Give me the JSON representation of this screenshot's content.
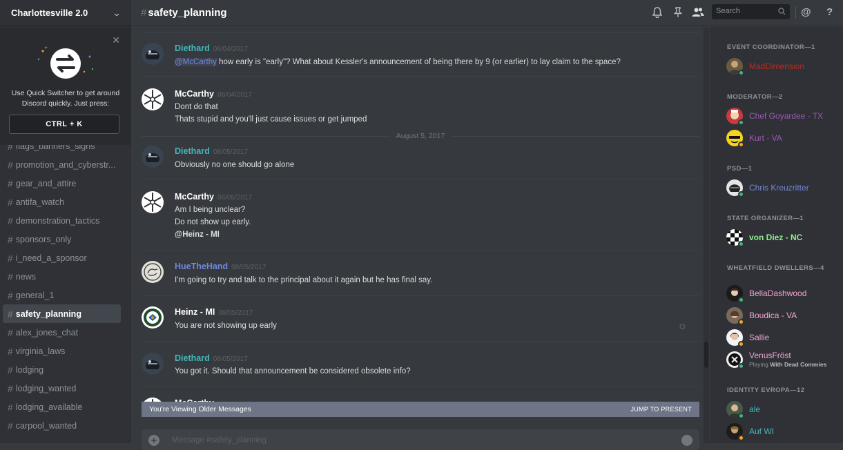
{
  "server": {
    "name": "Charlottesville 2.0"
  },
  "quick_switcher": {
    "text": "Use Quick Switcher to get around Discord quickly. Just press:",
    "shortcut": "CTRL + K"
  },
  "channels": [
    {
      "name": "flags_banners_signs",
      "active": false
    },
    {
      "name": "promotion_and_cyberstr...",
      "active": false
    },
    {
      "name": "gear_and_attire",
      "active": false
    },
    {
      "name": "antifa_watch",
      "active": false
    },
    {
      "name": "demonstration_tactics",
      "active": false
    },
    {
      "name": "sponsors_only",
      "active": false
    },
    {
      "name": "i_need_a_sponsor",
      "active": false
    },
    {
      "name": "news",
      "active": false
    },
    {
      "name": "general_1",
      "active": false
    },
    {
      "name": "safety_planning",
      "active": true
    },
    {
      "name": "alex_jones_chat",
      "active": false
    },
    {
      "name": "virginia_laws",
      "active": false
    },
    {
      "name": "lodging",
      "active": false
    },
    {
      "name": "lodging_wanted",
      "active": false
    },
    {
      "name": "lodging_available",
      "active": false
    },
    {
      "name": "carpool_wanted",
      "active": false
    }
  ],
  "header": {
    "channel": "safety_planning",
    "search_placeholder": "Search",
    "icons": [
      "bell-icon",
      "pin-icon",
      "members-icon",
      "mention-icon",
      "help-icon"
    ]
  },
  "messages": [
    {
      "author": "Diethard",
      "color": "#43b7b8",
      "timestamp": "08/04/2017",
      "avatar": "helmet",
      "lines": [
        {
          "mention": "@McCarthy",
          "text": " how early is \"early\"? What about Kessler's announcement of being there by 9 (or earlier) to lay claim to the space?"
        }
      ]
    },
    {
      "author": "McCarthy",
      "color": "#ffffff",
      "timestamp": "08/04/2017",
      "avatar": "snowflake",
      "lines": [
        {
          "text": "Dont do that"
        },
        {
          "text": "Thats stupid and you'll just cause issues or get jumped"
        }
      ]
    },
    {
      "author": "Diethard",
      "color": "#43b7b8",
      "timestamp": "08/05/2017",
      "avatar": "helmet",
      "lines": [
        {
          "text": "Obviously no one should go alone"
        }
      ]
    },
    {
      "author": "McCarthy",
      "color": "#ffffff",
      "timestamp": "08/05/2017",
      "avatar": "snowflake",
      "lines": [
        {
          "text": "Am I being unclear?"
        },
        {
          "text": "Do not show up early."
        },
        {
          "mention_bold": "@Heinz - MI"
        }
      ]
    },
    {
      "author": "HueTheHand",
      "color": "#7289da",
      "timestamp": "08/05/2017",
      "avatar": "hand",
      "lines": [
        {
          "text": "I'm going to try and talk to the principal about it again but he has final say."
        }
      ]
    },
    {
      "author": "Heinz - MI",
      "color": "#ffffff",
      "timestamp": "08/05/2017",
      "avatar": "seal",
      "lines": [
        {
          "text": "You are not showing up early"
        }
      ]
    },
    {
      "author": "Diethard",
      "color": "#43b7b8",
      "timestamp": "08/05/2017",
      "avatar": "helmet",
      "lines": [
        {
          "text": "You got it. Should that announcement be considered obsolete info?"
        }
      ]
    },
    {
      "author": "McCarthy",
      "color": "#ffffff",
      "timestamp": "",
      "avatar": "snowflake",
      "lines": []
    }
  ],
  "date_separator": "August 5, 2017",
  "older_messages_bar": {
    "text": "You're Viewing Older Messages",
    "jump": "JUMP TO PRESENT"
  },
  "composer": {
    "placeholder": "Message #safety_planning"
  },
  "member_groups": [
    {
      "role": "EVENT COORDINATOR—1",
      "members": [
        {
          "name": "MadDimension",
          "color": "#b32d22",
          "status": "online"
        }
      ]
    },
    {
      "role": "MODERATOR—2",
      "members": [
        {
          "name": "Chef Goyardee - TX",
          "color": "#9b59b6",
          "status": "online"
        },
        {
          "name": "Kurt - VA",
          "color": "#9b59b6",
          "status": "idle"
        }
      ]
    },
    {
      "role": "PSD—1",
      "members": [
        {
          "name": "Chris Kreuzritter",
          "color": "#7289da",
          "status": "online"
        }
      ]
    },
    {
      "role": "STATE ORGANIZER—1",
      "members": [
        {
          "name": "von Diez - NC",
          "color": "#8cf08c",
          "status": "online"
        }
      ]
    },
    {
      "role": "WHEATFIELD DWELLERS—4",
      "members": [
        {
          "name": "BellaDashwood",
          "color": "#f5a3d6",
          "status": "online"
        },
        {
          "name": "Boudica - VA",
          "color": "#f5a3d6",
          "status": "idle"
        },
        {
          "name": "Sallie",
          "color": "#f5a3d6",
          "status": "idle"
        },
        {
          "name": "VenusFröst",
          "color": "#f5a3d6",
          "status": "online",
          "activity_prefix": "Playing ",
          "activity": "With Dead Commies"
        }
      ]
    },
    {
      "role": "IDENTITY EVROPA—12",
      "members": [
        {
          "name": "ale",
          "color": "#43b7b8",
          "status": "online"
        },
        {
          "name": "Auf WI",
          "color": "#43b7b8",
          "status": "idle"
        }
      ]
    }
  ]
}
